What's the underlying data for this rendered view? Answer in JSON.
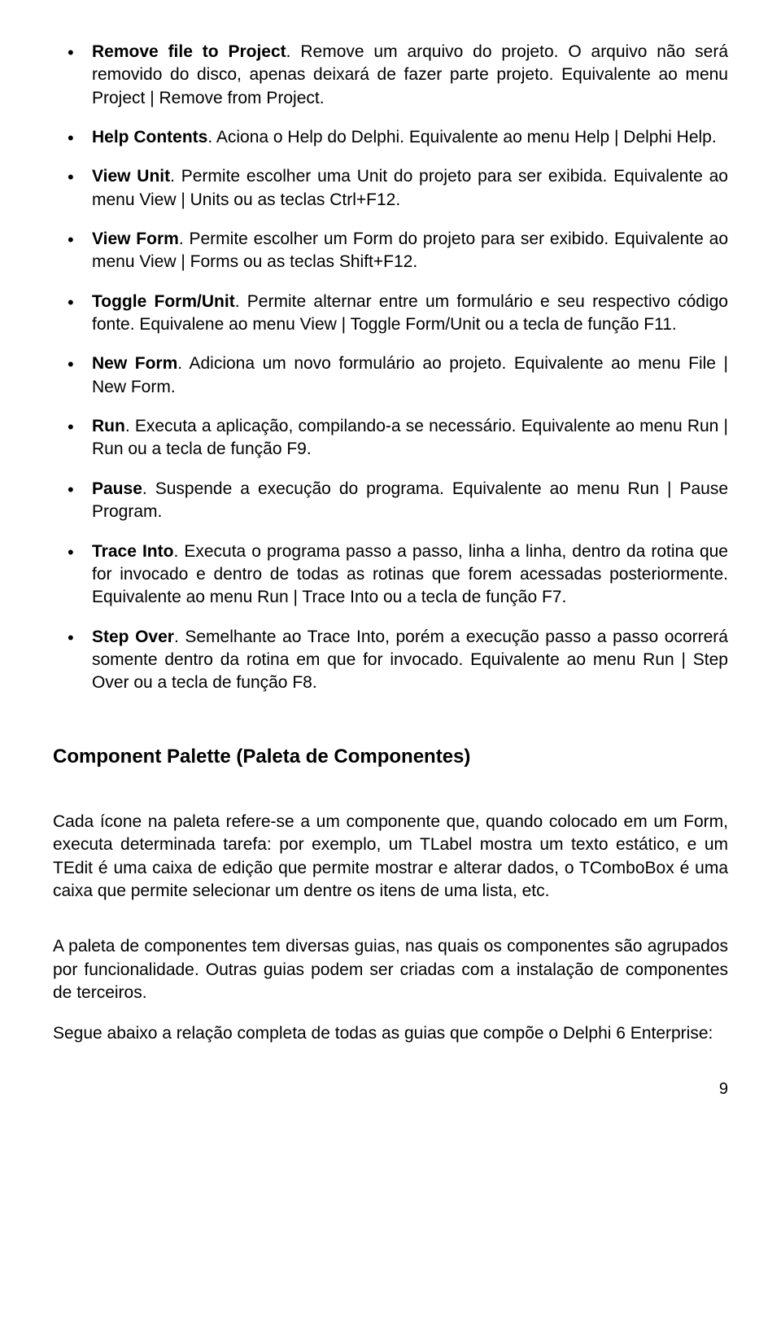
{
  "items": [
    {
      "bold": "Remove file to Project",
      "rest": ". Remove um arquivo do projeto. O arquivo não será removido do disco, apenas deixará de fazer parte projeto. Equivalente ao menu Project | Remove from Project."
    },
    {
      "bold": "Help Contents",
      "rest": ". Aciona o Help do Delphi. Equivalente ao menu Help | Delphi Help."
    },
    {
      "bold": "View Unit",
      "rest": ". Permite escolher uma Unit do projeto para ser exibida. Equivalente ao menu View | Units ou as teclas Ctrl+F12."
    },
    {
      "bold": "View Form",
      "rest": ". Permite escolher um Form do projeto para ser exibido. Equivalente ao menu View | Forms ou as teclas Shift+F12."
    },
    {
      "bold": "Toggle Form/Unit",
      "rest": ". Permite alternar entre um formulário e seu respectivo código fonte. Equivalene ao menu View | Toggle Form/Unit ou a tecla de função F11."
    },
    {
      "bold": "New Form",
      "rest": ". Adiciona um novo formulário ao projeto. Equivalente ao menu File | New Form."
    },
    {
      "bold": "Run",
      "rest": ". Executa a aplicação, compilando-a se necessário. Equivalente ao menu Run | Run ou a tecla de função F9."
    },
    {
      "bold": "Pause",
      "rest": ". Suspende a execução do programa. Equivalente ao menu Run | Pause Program."
    },
    {
      "bold": "Trace Into",
      "rest": ". Executa o programa passo a passo, linha a linha, dentro da rotina que for invocado e dentro de todas as rotinas que forem acessadas posteriormente. Equivalente ao menu Run | Trace Into ou a tecla de função F7."
    },
    {
      "bold": "Step Over",
      "rest": ". Semelhante ao Trace Into, porém a execução passo a passo ocorrerá somente dentro da rotina em que for invocado. Equivalente ao menu Run | Step Over ou a tecla de função F8."
    }
  ],
  "section_title": "Component Palette (Paleta de Componentes)",
  "paras": {
    "p1": "Cada ícone na paleta refere-se a um componente que, quando colocado em um Form, executa determinada tarefa: por exemplo, um TLabel mostra um texto estático, e um TEdit é uma caixa de edição que permite mostrar e alterar dados, o TComboBox é uma caixa que permite selecionar um dentre os itens de uma lista, etc.",
    "p2": "A paleta de componentes tem diversas guias, nas quais os componentes são agrupados por funcionalidade. Outras guias podem ser criadas com a instalação de componentes de terceiros.",
    "p3": "Segue abaixo a relação completa de todas as guias que compõe o Delphi 6 Enterprise:"
  },
  "page_number": "9"
}
